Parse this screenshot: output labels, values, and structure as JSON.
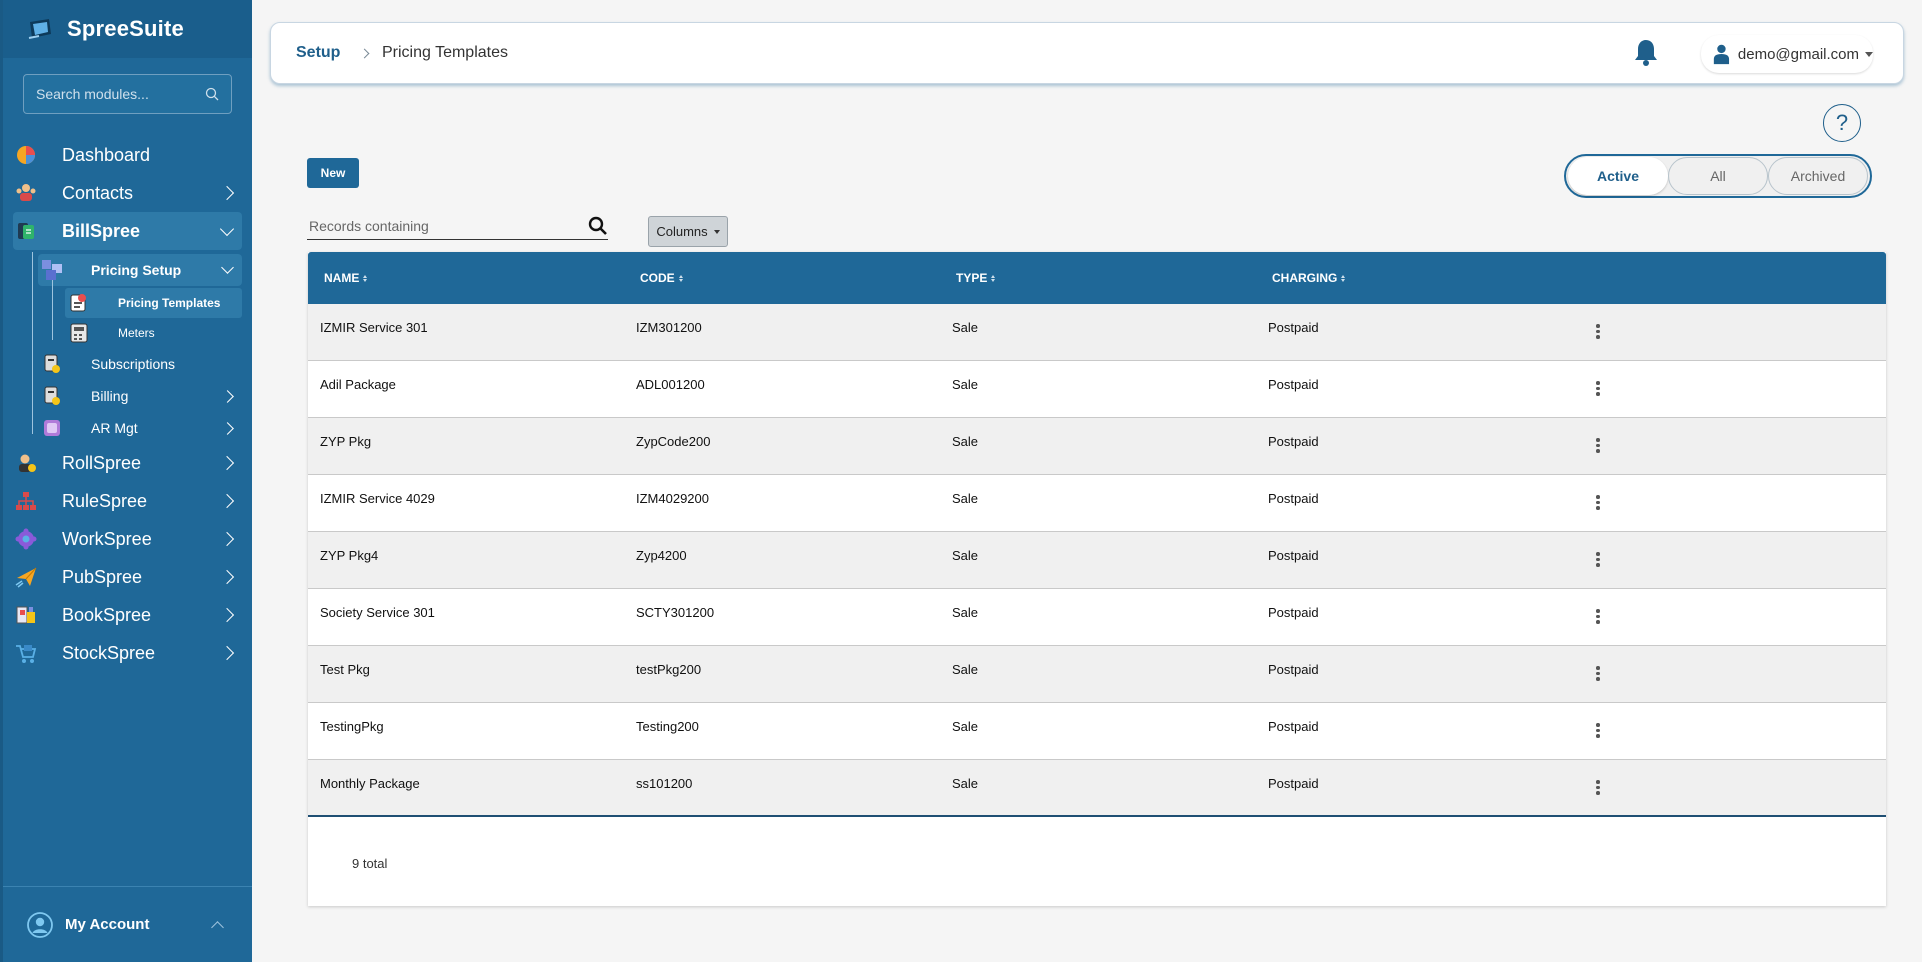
{
  "brand": {
    "name": "SpreeSuite"
  },
  "sidebar": {
    "search_placeholder": "Search modules...",
    "items": [
      {
        "label": "Dashboard",
        "icon": "pie-chart-icon"
      },
      {
        "label": "Contacts",
        "icon": "contacts-icon"
      },
      {
        "label": "BillSpree",
        "icon": "bill-icon"
      },
      {
        "label": "RollSpree",
        "icon": "payroll-icon"
      },
      {
        "label": "RuleSpree",
        "icon": "rules-icon"
      },
      {
        "label": "WorkSpree",
        "icon": "workflow-icon"
      },
      {
        "label": "PubSpree",
        "icon": "publish-icon"
      },
      {
        "label": "BookSpree",
        "icon": "books-icon"
      },
      {
        "label": "StockSpree",
        "icon": "stock-cart-icon"
      }
    ],
    "billspree_sub": [
      {
        "label": "Pricing Setup"
      },
      {
        "label": "Subscriptions"
      },
      {
        "label": "Billing"
      },
      {
        "label": "AR Mgt"
      }
    ],
    "pricing_sub": [
      {
        "label": "Pricing Templates"
      },
      {
        "label": "Meters"
      }
    ],
    "account_label": "My Account"
  },
  "header": {
    "crumb_root": "Setup",
    "crumb_page": "Pricing Templates",
    "user_email": "demo@gmail.com"
  },
  "toolbar": {
    "new_label": "New",
    "filter_options": [
      "Active",
      "All",
      "Archived"
    ],
    "filter_selected": "Active",
    "records_placeholder": "Records containing",
    "columns_label": "Columns"
  },
  "table": {
    "columns": [
      "NAME",
      "CODE",
      "TYPE",
      "CHARGING"
    ],
    "rows": [
      {
        "name": "IZMIR Service 301",
        "code": "IZM301200",
        "type": "Sale",
        "charging": "Postpaid"
      },
      {
        "name": "Adil Package",
        "code": "ADL001200",
        "type": "Sale",
        "charging": "Postpaid"
      },
      {
        "name": "ZYP Pkg",
        "code": "ZypCode200",
        "type": "Sale",
        "charging": "Postpaid"
      },
      {
        "name": "IZMIR Service 4029",
        "code": "IZM4029200",
        "type": "Sale",
        "charging": "Postpaid"
      },
      {
        "name": "ZYP Pkg4",
        "code": "Zyp4200",
        "type": "Sale",
        "charging": "Postpaid"
      },
      {
        "name": "Society Service 301",
        "code": "SCTY301200",
        "type": "Sale",
        "charging": "Postpaid"
      },
      {
        "name": "Test Pkg",
        "code": "testPkg200",
        "type": "Sale",
        "charging": "Postpaid"
      },
      {
        "name": "TestingPkg",
        "code": "Testing200",
        "type": "Sale",
        "charging": "Postpaid"
      },
      {
        "name": "Monthly Package",
        "code": "ss101200",
        "type": "Sale",
        "charging": "Postpaid"
      }
    ],
    "total_label": "9 total"
  },
  "colors": {
    "primary": "#1f6898",
    "sidebar": "#1f6898",
    "header_text": "#1f5f8b"
  }
}
